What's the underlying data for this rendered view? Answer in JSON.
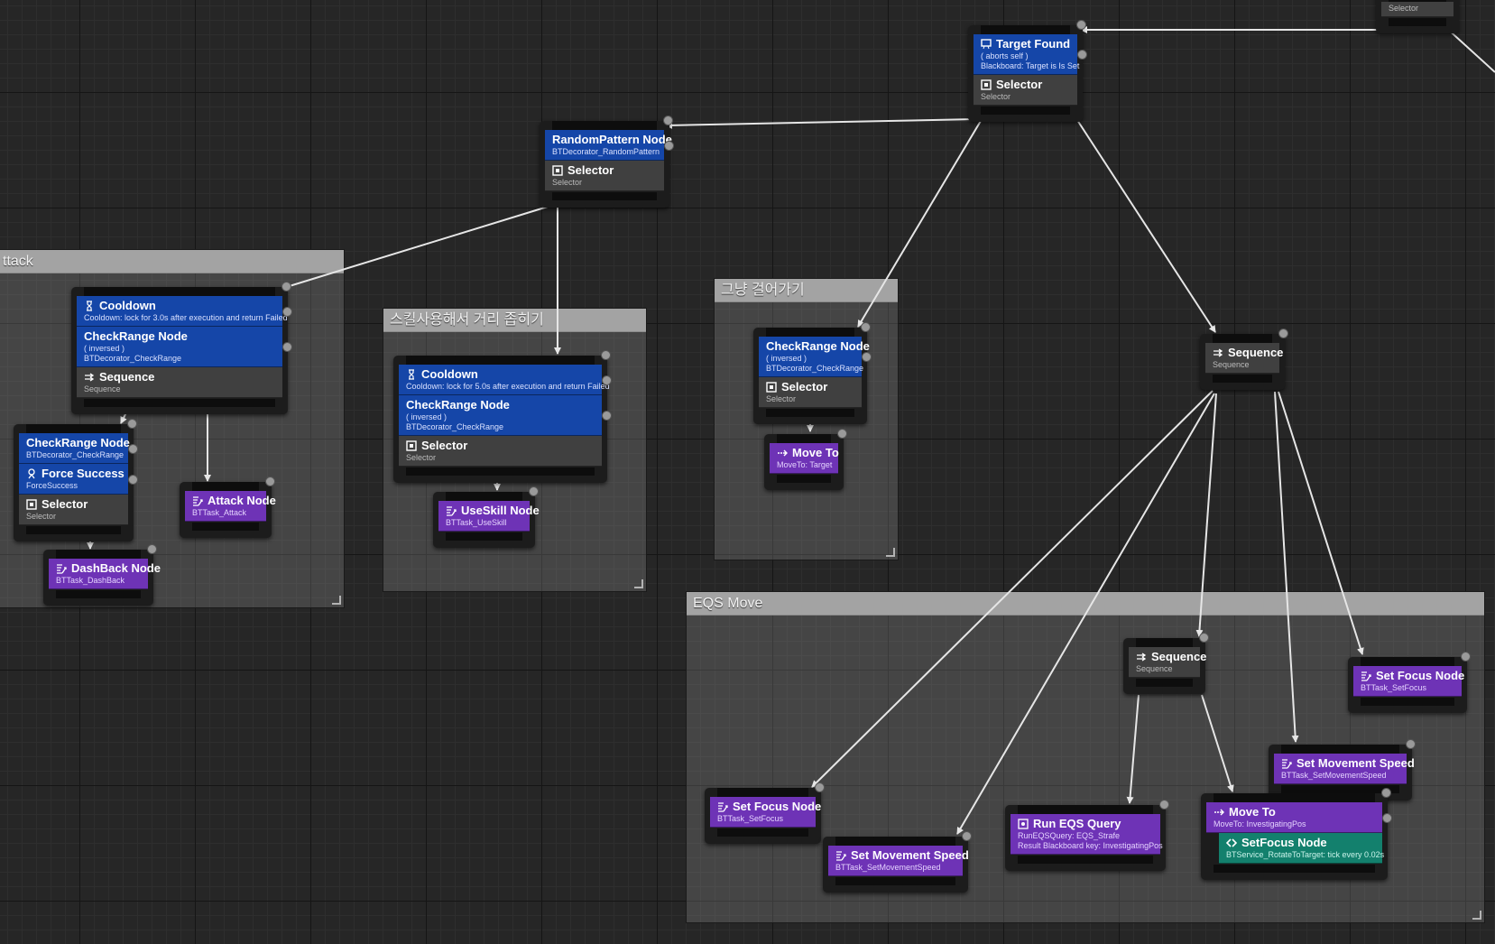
{
  "comments": [
    {
      "key": "c_attack",
      "title": "ttack"
    },
    {
      "key": "c_skill",
      "title": "스킬사용해서 거리 좁히기"
    },
    {
      "key": "c_walk",
      "title": "그냥 걸어가기"
    },
    {
      "key": "c_eqs",
      "title": "EQS Move"
    }
  ],
  "nodes": {
    "selector_corner": {
      "label": "Selector"
    },
    "target_found": {
      "decorator_title": "Target Found",
      "decorator_line1": "( aborts self )",
      "decorator_line2": "Blackboard: Target is Is Set",
      "title": "Selector",
      "subtitle": "Selector"
    },
    "random_pattern": {
      "decorator_title": "RandomPattern Node",
      "decorator_sub": "BTDecorator_RandomPattern",
      "title": "Selector",
      "subtitle": "Selector"
    },
    "attack_seq": {
      "cooldown_title": "Cooldown",
      "cooldown_sub": "Cooldown: lock for 3.0s after execution and return Failed",
      "check_title": "CheckRange Node",
      "check_line1": "( inversed )",
      "check_line2": "BTDecorator_CheckRange",
      "title": "Sequence",
      "subtitle": "Sequence"
    },
    "attack_sel": {
      "check_title": "CheckRange Node",
      "check_sub": "BTDecorator_CheckRange",
      "force_title": "Force Success",
      "force_sub": "ForceSuccess",
      "title": "Selector",
      "subtitle": "Selector"
    },
    "attack_task": {
      "title": "Attack Node",
      "subtitle": "BTTask_Attack"
    },
    "dashback_task": {
      "title": "DashBack Node",
      "subtitle": "BTTask_DashBack"
    },
    "skill_sel": {
      "cooldown_title": "Cooldown",
      "cooldown_sub": "Cooldown: lock for 5.0s after execution and return Failed",
      "check_title": "CheckRange Node",
      "check_line1": "( inversed )",
      "check_line2": "BTDecorator_CheckRange",
      "title": "Selector",
      "subtitle": "Selector"
    },
    "useskill_task": {
      "title": "UseSkill Node",
      "subtitle": "BTTask_UseSkill"
    },
    "walk_sel": {
      "check_title": "CheckRange Node",
      "check_line1": "( inversed )",
      "check_line2": "BTDecorator_CheckRange",
      "title": "Selector",
      "subtitle": "Selector"
    },
    "moveto_target": {
      "title": "Move To",
      "subtitle": "MoveTo: Target"
    },
    "main_seq": {
      "title": "Sequence",
      "subtitle": "Sequence"
    },
    "eqs_seq": {
      "title": "Sequence",
      "subtitle": "Sequence"
    },
    "setfocus_right": {
      "title": "Set Focus Node",
      "subtitle": "BTTask_SetFocus"
    },
    "setmovespeed_right": {
      "title": "Set Movement Speed",
      "subtitle": "BTTask_SetMovementSpeed"
    },
    "setfocus_left": {
      "title": "Set Focus Node",
      "subtitle": "BTTask_SetFocus"
    },
    "setmovespeed_left": {
      "title": "Set Movement Speed",
      "subtitle": "BTTask_SetMovementSpeed"
    },
    "run_eqs": {
      "title": "Run EQS Query",
      "line1": "RunEQSQuery: EQS_Strafe",
      "line2": "Result Blackboard key: InvestigatingPos"
    },
    "moveto_investigate": {
      "title": "Move To",
      "subtitle": "MoveTo: InvestigatingPos",
      "service_title": "SetFocus Node",
      "service_sub": "BTService_RotateToTarget: tick every 0.02s"
    }
  },
  "colors": {
    "decorator": "#1546a8",
    "composite": "#404040",
    "task": "#6e33b6",
    "service": "#13806d",
    "wire": "#e6e6e6"
  },
  "icons": [
    "selector-icon",
    "sequence-icon",
    "task-icon",
    "cooldown-icon",
    "blackboard-icon",
    "force-success-icon",
    "moveto-icon",
    "eqs-icon",
    "service-icon"
  ]
}
